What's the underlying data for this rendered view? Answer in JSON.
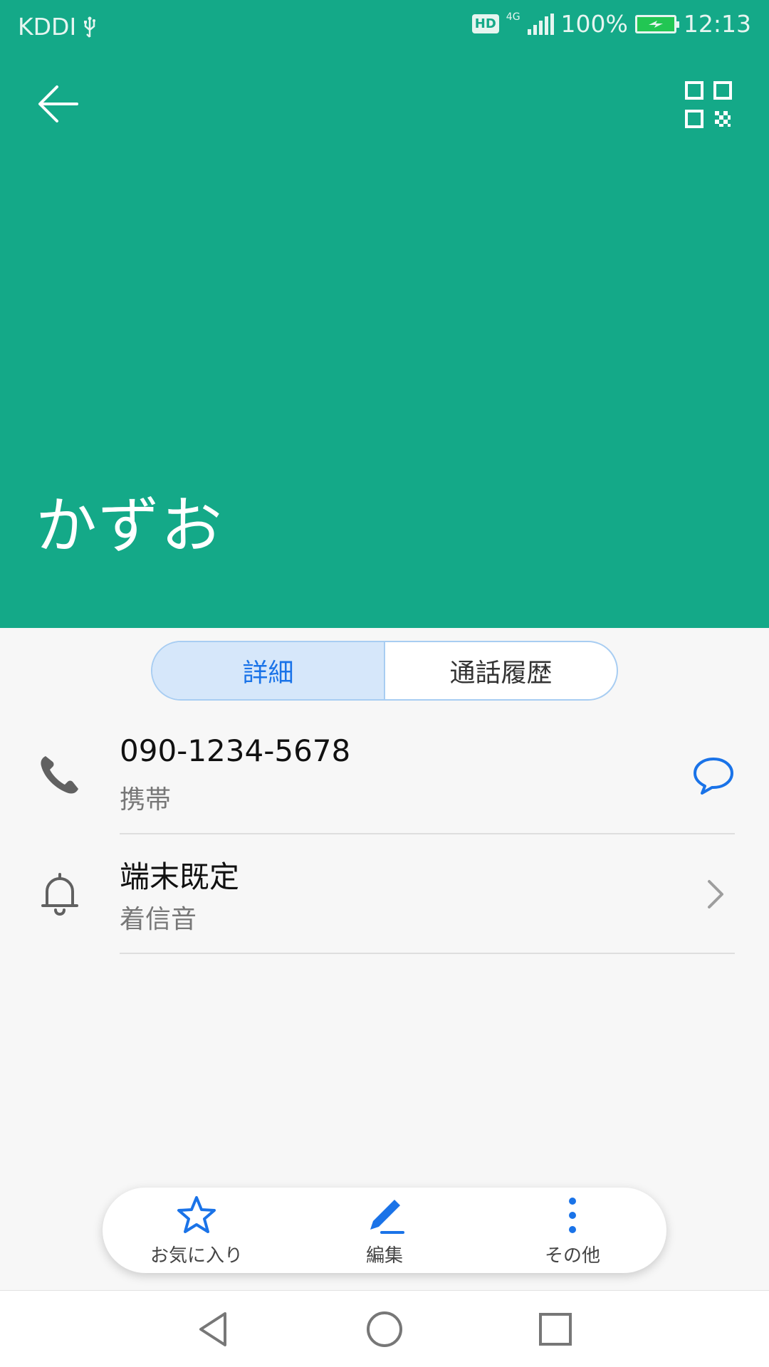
{
  "status_bar": {
    "carrier": "KDDI",
    "hd_badge": "HD",
    "network": "4G",
    "battery": "100%",
    "time": "12:13",
    "colors": {
      "battery_fill": "#22c653"
    }
  },
  "header": {
    "color": "#14a988",
    "back_icon": "arrow-left-icon",
    "qr_icon": "qr-code-icon",
    "contact_name": "かずお"
  },
  "tabs": [
    {
      "label": "詳細",
      "active": true
    },
    {
      "label": "通話履歴",
      "active": false
    }
  ],
  "details": [
    {
      "icon": "phone-icon",
      "primary": "090-1234-5678",
      "secondary": "携帯",
      "trailing_icon": "message-icon"
    },
    {
      "icon": "bell-icon",
      "primary": "端末既定",
      "secondary": "着信音",
      "trailing_icon": "chevron-right-icon"
    }
  ],
  "actions": [
    {
      "icon": "star-icon",
      "label": "お気に入り"
    },
    {
      "icon": "edit-pen-icon",
      "label": "編集"
    },
    {
      "icon": "more-vertical-icon",
      "label": "その他"
    }
  ],
  "accent_color": "#1a73e8",
  "navigation_bar": [
    "back-triangle-icon",
    "home-circle-icon",
    "recents-square-icon"
  ]
}
